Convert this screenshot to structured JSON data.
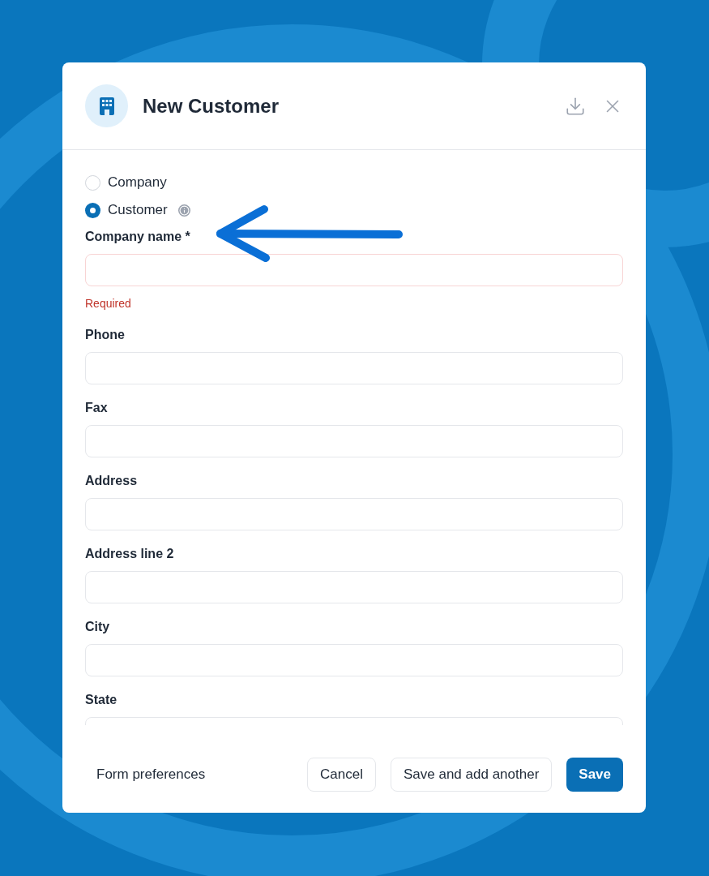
{
  "dialog": {
    "title": "New Customer"
  },
  "radios": [
    {
      "label": "Company",
      "selected": false,
      "info": false
    },
    {
      "label": "Customer",
      "selected": true,
      "info": true
    }
  ],
  "fields": [
    {
      "label": "Company name *",
      "error": "Required"
    },
    {
      "label": "Phone"
    },
    {
      "label": "Fax"
    },
    {
      "label": "Address"
    },
    {
      "label": "Address line 2"
    },
    {
      "label": "City"
    },
    {
      "label": "State"
    }
  ],
  "footer": {
    "link": "Form preferences",
    "buttons": [
      {
        "label": "Cancel",
        "kind": "secondary"
      },
      {
        "label": "Save and add another",
        "kind": "secondary"
      },
      {
        "label": "Save",
        "kind": "primary"
      }
    ]
  }
}
